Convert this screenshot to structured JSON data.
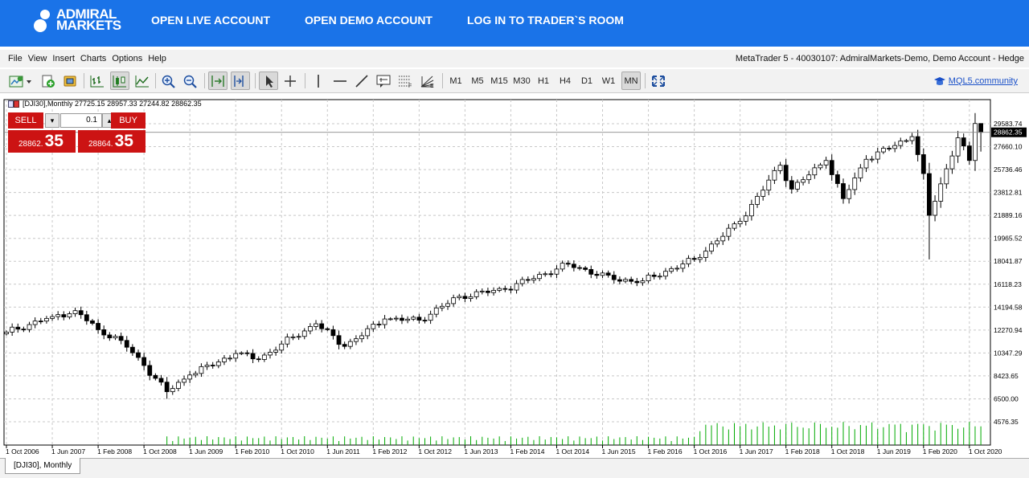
{
  "brand": {
    "line1": "ADMIRAL",
    "line2": "MARKETS"
  },
  "topnav": {
    "items": [
      {
        "label": "OPEN LIVE ACCOUNT"
      },
      {
        "label": "OPEN DEMO ACCOUNT"
      },
      {
        "label": "LOG IN TO TRADER`S ROOM"
      }
    ]
  },
  "menubar": {
    "items": [
      {
        "label": "File"
      },
      {
        "label": "View"
      },
      {
        "label": "Insert"
      },
      {
        "label": "Charts"
      },
      {
        "label": "Options"
      },
      {
        "label": "Help"
      }
    ],
    "window_title": "MetaTrader 5 - 40030107: AdmiralMarkets-Demo, Demo Account - Hedge"
  },
  "toolbar": {
    "timeframes": [
      "M1",
      "M5",
      "M15",
      "M30",
      "H1",
      "H4",
      "D1",
      "W1",
      "MN"
    ],
    "active_timeframe": "MN",
    "mql_link": "MQL5.community",
    "icons": [
      "new-chart-icon",
      "add-chart-icon",
      "market-icon",
      "bar-chart-icon",
      "candlestick-icon",
      "line-chart-icon",
      "zoom-in-icon",
      "zoom-out-icon",
      "autoscroll-icon",
      "chart-shift-icon",
      "cursor-icon",
      "crosshair-icon",
      "vertical-line-icon",
      "horizontal-line-icon",
      "trend-line-icon",
      "text-label-icon",
      "fibonacci-icon",
      "fibonacci-fan-icon",
      "fullscreen-icon"
    ]
  },
  "chart": {
    "label": "[DJI30],Monthly  27725.15 28957.33 27244.82 28862.35",
    "current_price": "28862.35",
    "background": "#ffffff",
    "grid": "dashed",
    "up_candle_color": "#ffffff",
    "down_candle_color": "#000000",
    "volume_color": "#00aa00"
  },
  "trade_panel": {
    "sell_label": "SELL",
    "buy_label": "BUY",
    "lot": "0.1",
    "sell_price_small": "28862.",
    "sell_price_big": "35",
    "buy_price_small": "28864.",
    "buy_price_big": "35"
  },
  "chart_data": {
    "type": "candlestick",
    "symbol": "DJI30",
    "timeframe": "Monthly",
    "y_ticks": [
      "29583.74",
      "27660.10",
      "25736.46",
      "23812.81",
      "21889.16",
      "19965.52",
      "18041.87",
      "16118.23",
      "14194.58",
      "12270.94",
      "10347.29",
      "8423.65",
      "6500.00",
      "4576.35"
    ],
    "ylim": [
      4576.35,
      29583.74
    ],
    "x_ticks": [
      "1 Oct 2006",
      "1 Jun 2007",
      "1 Feb 2008",
      "1 Oct 2008",
      "1 Jun 2009",
      "1 Feb 2010",
      "1 Oct 2010",
      "1 Jun 2011",
      "1 Feb 2012",
      "1 Oct 2012",
      "1 Jun 2013",
      "1 Feb 2014",
      "1 Oct 2014",
      "1 Jun 2015",
      "1 Feb 2016",
      "1 Oct 2016",
      "1 Jun 2017",
      "1 Feb 2018",
      "1 Oct 2018",
      "1 Jun 2019",
      "1 Feb 2020",
      "1 Oct 2020"
    ],
    "close_anchors": [
      {
        "month": "2006-10",
        "close": 12100
      },
      {
        "month": "2007-06",
        "close": 13400
      },
      {
        "month": "2007-10",
        "close": 13900
      },
      {
        "month": "2008-02",
        "close": 12300
      },
      {
        "month": "2008-06",
        "close": 11400
      },
      {
        "month": "2008-10",
        "close": 9300
      },
      {
        "month": "2009-02",
        "close": 7100
      },
      {
        "month": "2009-06",
        "close": 8500
      },
      {
        "month": "2010-02",
        "close": 10300
      },
      {
        "month": "2010-06",
        "close": 9800
      },
      {
        "month": "2010-10",
        "close": 11100
      },
      {
        "month": "2011-04",
        "close": 12800
      },
      {
        "month": "2011-09",
        "close": 10900
      },
      {
        "month": "2012-04",
        "close": 13200
      },
      {
        "month": "2012-10",
        "close": 13100
      },
      {
        "month": "2013-05",
        "close": 15100
      },
      {
        "month": "2014-01",
        "close": 15700
      },
      {
        "month": "2014-12",
        "close": 17800
      },
      {
        "month": "2015-08",
        "close": 16500
      },
      {
        "month": "2016-01",
        "close": 16400
      },
      {
        "month": "2016-10",
        "close": 18200
      },
      {
        "month": "2017-06",
        "close": 21400
      },
      {
        "month": "2018-01",
        "close": 26100
      },
      {
        "month": "2018-03",
        "close": 24100
      },
      {
        "month": "2018-09",
        "close": 26500
      },
      {
        "month": "2018-12",
        "close": 23300
      },
      {
        "month": "2019-04",
        "close": 26600
      },
      {
        "month": "2019-12",
        "close": 28500
      },
      {
        "month": "2020-02",
        "close": 25400
      },
      {
        "month": "2020-03",
        "close": 21900
      },
      {
        "month": "2020-06",
        "close": 25800
      },
      {
        "month": "2020-08",
        "close": 28400
      },
      {
        "month": "2020-10",
        "close": 26500
      },
      {
        "month": "2020-11",
        "close": 29600
      },
      {
        "month": "2020-12",
        "close": 28862.35
      }
    ],
    "last_bar": {
      "open": 27725.15,
      "high": 28957.33,
      "low": 27244.82,
      "close": 28862.35
    }
  },
  "bottom_tab": {
    "label": "[DJI30], Monthly"
  }
}
